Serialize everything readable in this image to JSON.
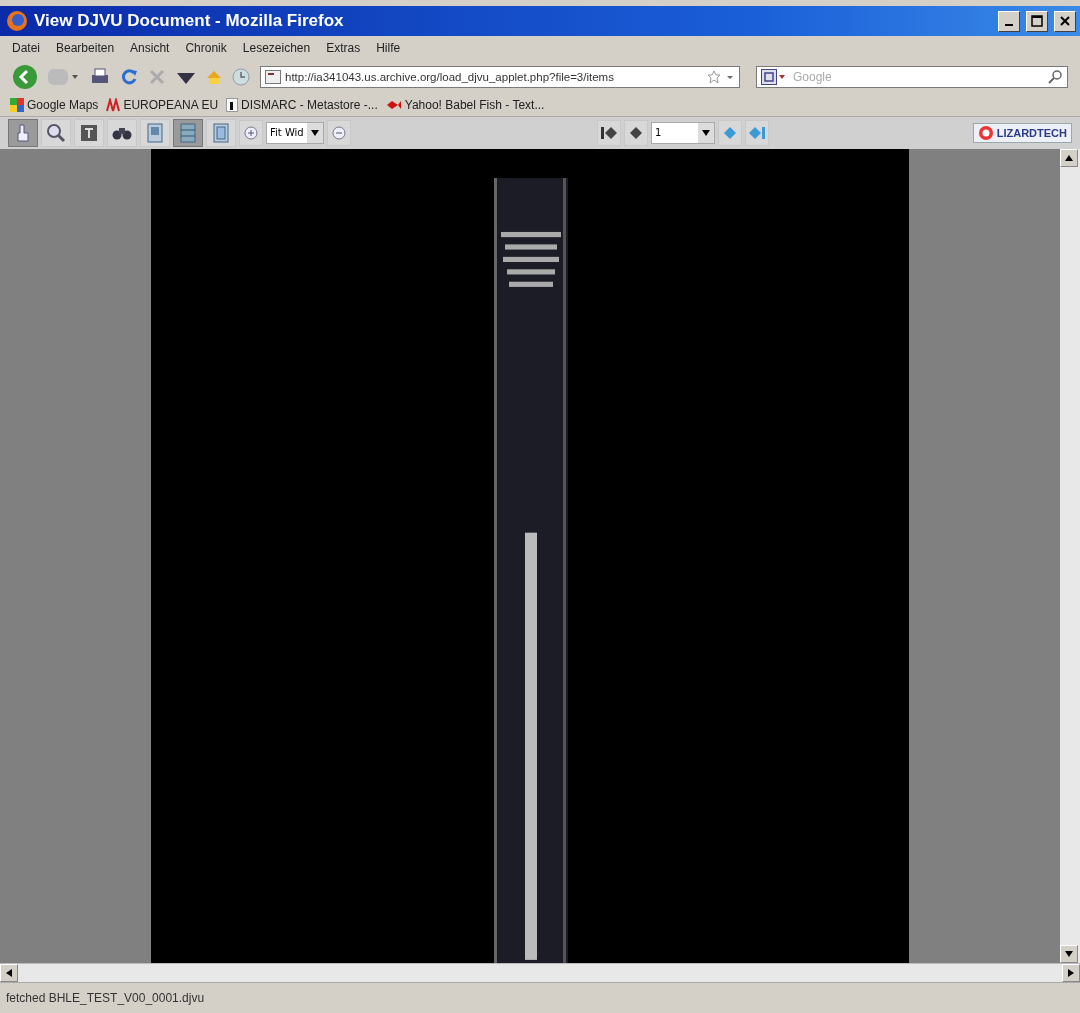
{
  "window": {
    "title": "View DJVU Document - Mozilla Firefox"
  },
  "menu": [
    {
      "label": "Datei"
    },
    {
      "label": "Bearbeiten"
    },
    {
      "label": "Ansicht"
    },
    {
      "label": "Chronik"
    },
    {
      "label": "Lesezeichen"
    },
    {
      "label": "Extras"
    },
    {
      "label": "Hilfe"
    }
  ],
  "navigation": {
    "url": "http://ia341043.us.archive.org/load_djvu_applet.php?file=3/items",
    "search": {
      "placeholder": "Google"
    }
  },
  "bookmarks": [
    {
      "label": "Google Maps",
      "kind": "map"
    },
    {
      "label": "EUROPEANA EU",
      "kind": "europeana"
    },
    {
      "label": "DISMARC - Metastore -...",
      "kind": "page"
    },
    {
      "label": "Yahoo! Babel Fish - Text...",
      "kind": "fish"
    }
  ],
  "viewer_toolbar": {
    "tools": [
      {
        "kind": "select",
        "selected": true
      },
      {
        "kind": "zoom",
        "selected": false
      },
      {
        "kind": "text",
        "selected": false
      },
      {
        "kind": "find",
        "selected": false
      },
      {
        "kind": "single",
        "selected": false
      },
      {
        "kind": "continuous",
        "selected": true
      },
      {
        "kind": "facing",
        "selected": false
      }
    ],
    "zoom": {
      "value": "Fit Wid"
    },
    "page": {
      "value": "1"
    },
    "logo": "LIZARDTECH"
  },
  "status_bar": {
    "text": "fetched BHLE_TEST_V00_0001.djvu"
  }
}
